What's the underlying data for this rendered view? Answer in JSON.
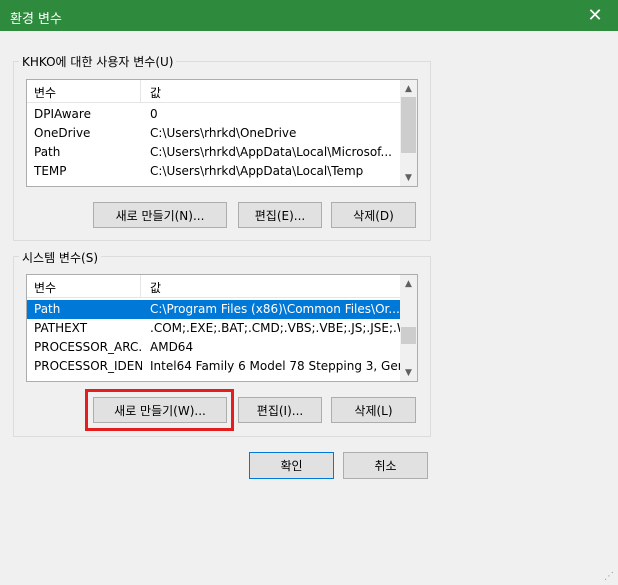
{
  "window": {
    "title": "환경 변수",
    "close_glyph": "✕"
  },
  "user_vars": {
    "group_label": "KHKO에 대한 사용자 변수(U)",
    "col_var": "변수",
    "col_val": "값",
    "rows": [
      {
        "name": "DPIAware",
        "value": "0"
      },
      {
        "name": "OneDrive",
        "value": "C:\\Users\\rhrkd\\OneDrive"
      },
      {
        "name": "Path",
        "value": "C:\\Users\\rhrkd\\AppData\\Local\\Microsof..."
      },
      {
        "name": "TEMP",
        "value": "C:\\Users\\rhrkd\\AppData\\Local\\Temp"
      }
    ],
    "new_btn": "새로 만들기(N)...",
    "edit_btn": "편집(E)...",
    "delete_btn": "삭제(D)"
  },
  "system_vars": {
    "group_label": "시스템 변수(S)",
    "col_var": "변수",
    "col_val": "값",
    "rows": [
      {
        "name": "Path",
        "value": "C:\\Program Files (x86)\\Common Files\\Or...",
        "selected": true
      },
      {
        "name": "PATHEXT",
        "value": ".COM;.EXE;.BAT;.CMD;.VBS;.VBE;.JS;.JSE;.W..."
      },
      {
        "name": "PROCESSOR_ARC...",
        "value": "AMD64"
      },
      {
        "name": "PROCESSOR_IDEN...",
        "value": "Intel64 Family 6 Model 78 Stepping 3, Gen..."
      }
    ],
    "new_btn": "새로 만들기(W)...",
    "edit_btn": "편집(I)...",
    "delete_btn": "삭제(L)"
  },
  "footer": {
    "ok_btn": "확인",
    "cancel_btn": "취소"
  },
  "colors": {
    "titlebar": "#2e8b3e",
    "selection": "#0078d7",
    "highlight": "#e41e1e"
  }
}
